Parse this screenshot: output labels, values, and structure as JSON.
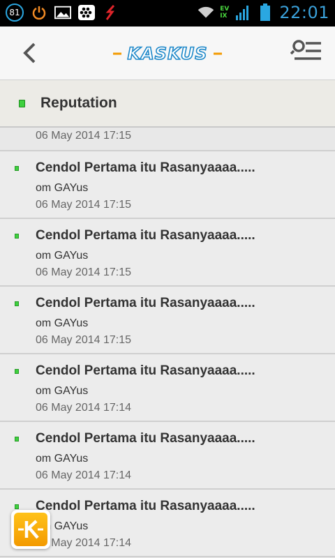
{
  "status_bar": {
    "notification_count": "81",
    "network_labels": [
      "EV",
      "IX"
    ],
    "time": "22:01",
    "icons": [
      "power-icon",
      "image-icon",
      "bbm-icon",
      "slash-icon",
      "wifi-icon",
      "signal-icon",
      "battery-icon"
    ]
  },
  "header": {
    "logo_text": "KASKUS",
    "back_icon": "chevron-left-icon",
    "menu_icon": "search-menu-icon"
  },
  "section": {
    "title": "Reputation"
  },
  "partial_item": {
    "date": "06 May 2014 17:15"
  },
  "items": [
    {
      "title": "Cendol Pertama itu Rasanyaaaa.....",
      "author": "om GAYus",
      "date": "06 May 2014 17:15"
    },
    {
      "title": "Cendol Pertama itu Rasanyaaaa.....",
      "author": "om GAYus",
      "date": "06 May 2014 17:15"
    },
    {
      "title": "Cendol Pertama itu Rasanyaaaa.....",
      "author": "om GAYus",
      "date": "06 May 2014 17:15"
    },
    {
      "title": "Cendol Pertama itu Rasanyaaaa.....",
      "author": "om GAYus",
      "date": "06 May 2014 17:14"
    },
    {
      "title": "Cendol Pertama itu Rasanyaaaa.....",
      "author": "om GAYus",
      "date": "06 May 2014 17:14"
    },
    {
      "title": "Cendol Pertama itu Rasanyaaaa.....",
      "author": "om GAYus",
      "date": "06 May 2014 17:14"
    }
  ],
  "colors": {
    "accent_blue": "#1e88c9",
    "logo_orange": "#f39a00",
    "reputation_green": "#3ed03e",
    "time_blue": "#3aa0d9"
  }
}
